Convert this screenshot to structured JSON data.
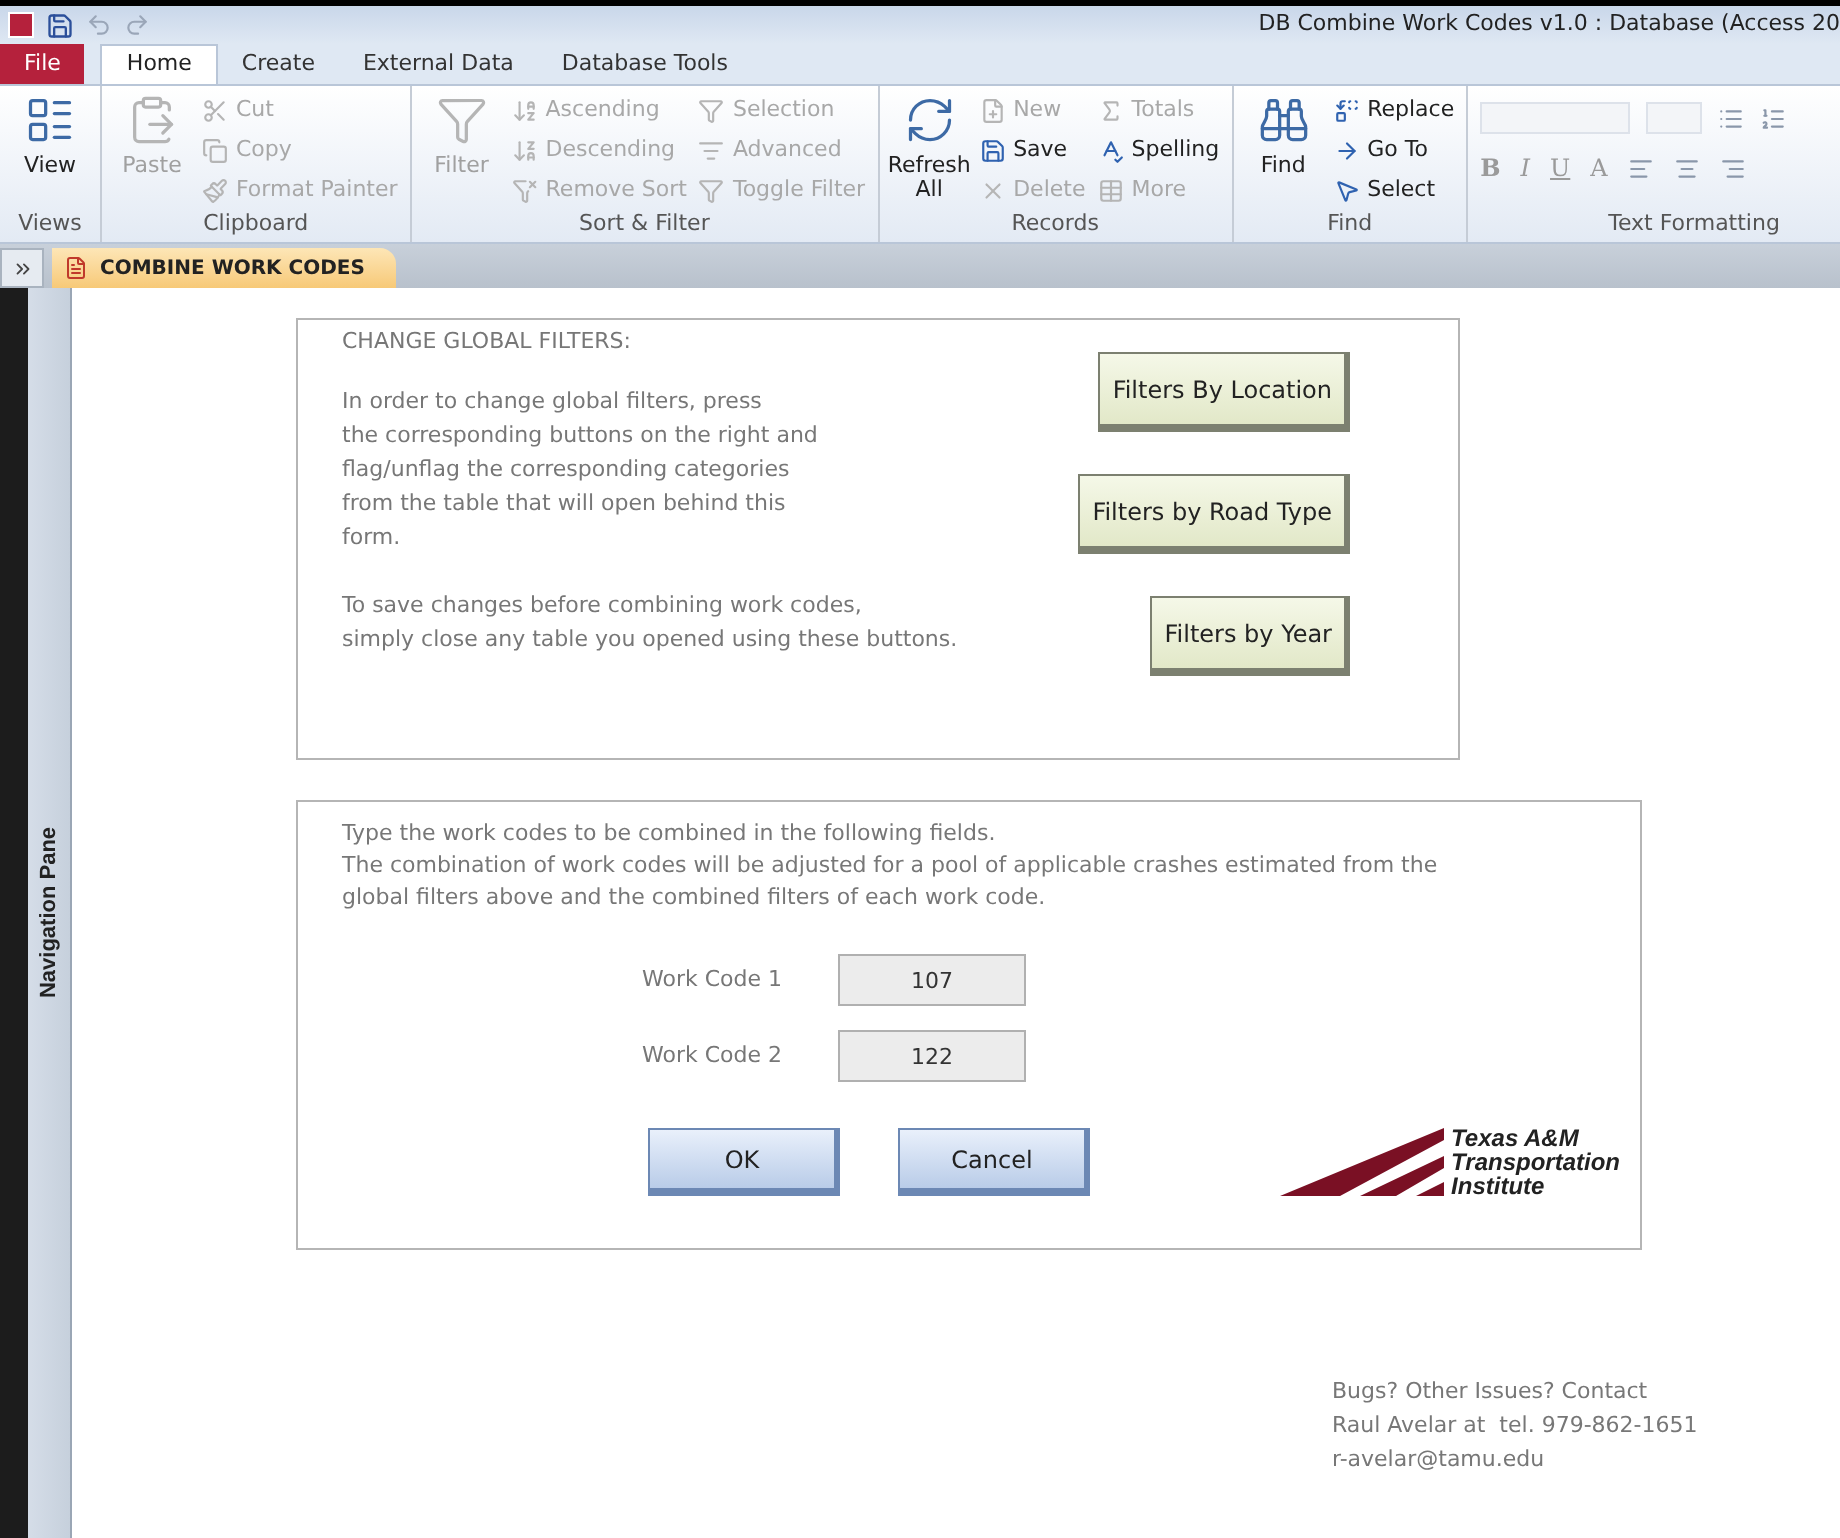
{
  "window": {
    "title": "DB Combine Work Codes v1.0 : Database (Access 20"
  },
  "ribbon_tabs": [
    {
      "label": "File",
      "kind": "file",
      "selected": false
    },
    {
      "label": "Home",
      "kind": "tab",
      "selected": true
    },
    {
      "label": "Create",
      "kind": "tab",
      "selected": false
    },
    {
      "label": "External Data",
      "kind": "tab",
      "selected": false
    },
    {
      "label": "Database Tools",
      "kind": "tab",
      "selected": false
    }
  ],
  "ribbon_groups": [
    {
      "label": "Views",
      "large": [
        {
          "label": "View",
          "disabled": false
        }
      ]
    },
    {
      "label": "Clipboard",
      "large": [
        {
          "label": "Paste",
          "disabled": true
        }
      ],
      "columns": [
        [
          {
            "label": "Cut",
            "disabled": true
          },
          {
            "label": "Copy",
            "disabled": true
          },
          {
            "label": "Format Painter",
            "disabled": true
          }
        ]
      ]
    },
    {
      "label": "Sort & Filter",
      "large": [
        {
          "label": "Filter",
          "disabled": true
        }
      ],
      "columns": [
        [
          {
            "label": "Ascending",
            "disabled": true
          },
          {
            "label": "Descending",
            "disabled": true
          },
          {
            "label": "Remove Sort",
            "disabled": true
          }
        ],
        [
          {
            "label": "Selection",
            "disabled": true
          },
          {
            "label": "Advanced",
            "disabled": true
          },
          {
            "label": "Toggle Filter",
            "disabled": true
          }
        ]
      ]
    },
    {
      "label": "Records",
      "large": [
        {
          "label": "Refresh All",
          "disabled": false
        }
      ],
      "columns": [
        [
          {
            "label": "New",
            "disabled": true
          },
          {
            "label": "Save",
            "disabled": false
          },
          {
            "label": "Delete",
            "disabled": true
          }
        ],
        [
          {
            "label": "Totals",
            "disabled": true
          },
          {
            "label": "Spelling",
            "disabled": false
          },
          {
            "label": "More",
            "disabled": true
          }
        ]
      ]
    },
    {
      "label": "Find",
      "large": [
        {
          "label": "Find",
          "disabled": false
        }
      ],
      "columns": [
        [
          {
            "label": "Replace",
            "disabled": false
          },
          {
            "label": "Go To",
            "disabled": false
          },
          {
            "label": "Select",
            "disabled": false
          }
        ]
      ]
    }
  ],
  "text_formatting": {
    "label": "Text Formatting",
    "buttons": [
      "B",
      "I",
      "U",
      "A"
    ]
  },
  "document_tab": {
    "label": "COMBINE WORK CODES"
  },
  "navigation_pane": {
    "label": "Navigation Pane"
  },
  "filters_panel": {
    "heading": "CHANGE GLOBAL FILTERS:",
    "paragraphs": [
      [
        "In order to change global filters, press",
        "the corresponding buttons on the right and",
        "flag/unflag the corresponding categories",
        "from the table that will open behind this",
        "form."
      ],
      [
        "To save changes before combining work codes,",
        "simply close any table you opened using these buttons."
      ]
    ],
    "buttons": [
      "Filters By Location",
      "Filters by Road Type",
      "Filters by Year"
    ]
  },
  "codes_panel": {
    "intro": [
      "Type the work codes to be combined in the following fields.",
      "The combination of work codes will be adjusted for a pool of applicable crashes estimated from the",
      "global filters above and the combined filters of each work code."
    ],
    "fields": [
      {
        "label": "Work Code 1",
        "value": "107"
      },
      {
        "label": "Work Code 2",
        "value": "122"
      }
    ],
    "buttons": [
      "OK",
      "Cancel"
    ],
    "logo_lines": [
      "Texas A&M",
      "Transportation",
      "Institute"
    ]
  },
  "contact": [
    "Bugs? Other Issues? Contact",
    "Raul Avelar at  tel. 979-862-1651",
    "r-avelar@tamu.edu"
  ]
}
